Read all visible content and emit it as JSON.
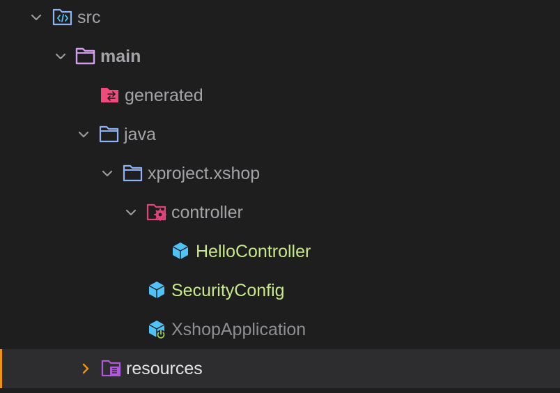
{
  "tree": {
    "items": [
      {
        "label": "src",
        "expanded": true,
        "icon": "source-folder-icon"
      },
      {
        "label": "main",
        "expanded": true,
        "icon": "folder-icon"
      },
      {
        "label": "generated",
        "icon": "generated-folder-icon"
      },
      {
        "label": "java",
        "expanded": true,
        "icon": "folder-icon"
      },
      {
        "label": "xproject.xshop",
        "expanded": true,
        "icon": "package-folder-icon"
      },
      {
        "label": "controller",
        "expanded": true,
        "icon": "controller-folder-icon"
      },
      {
        "label": "HelloController",
        "icon": "class-icon"
      },
      {
        "label": "SecurityConfig",
        "icon": "class-icon"
      },
      {
        "label": "XshopApplication",
        "icon": "spring-boot-class-icon"
      },
      {
        "label": "resources",
        "expanded": false,
        "selected": true,
        "icon": "resources-folder-icon"
      }
    ]
  },
  "colors": {
    "background": "#1e1e1f",
    "selected_row": "#2d2d30",
    "selection_accent": "#f0930e",
    "text_default": "#a4a4a8",
    "text_modified": "#c8e88a",
    "folder_blue": "#8fb4f5",
    "folder_purple": "#d59cf0",
    "folder_pink": "#f04a7c",
    "class_icon": "#4fc3f7"
  }
}
